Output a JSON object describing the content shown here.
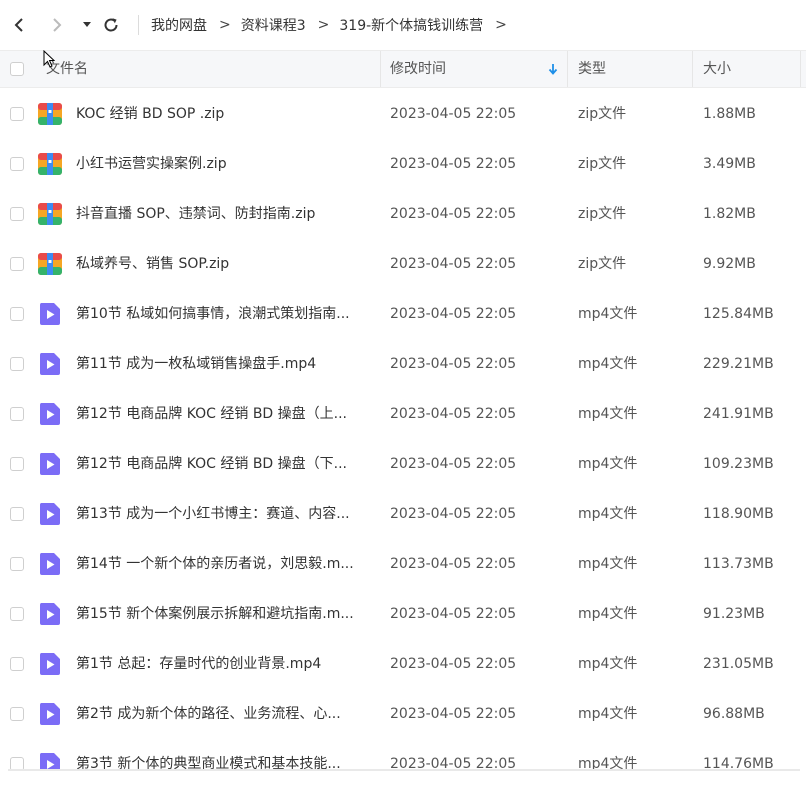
{
  "toolbar": {
    "back_icon": "chevron-left-icon",
    "forward_icon": "chevron-right-icon",
    "dropdown_icon": "caret-down-icon",
    "refresh_icon": "refresh-icon"
  },
  "breadcrumb": [
    "我的网盘",
    "资料课程3",
    "319-新个体搞钱训练营"
  ],
  "breadcrumb_separator": ">",
  "columns": {
    "name": "文件名",
    "modified": "修改时间",
    "type": "类型",
    "size": "大小"
  },
  "sort_icon": "sort-down-arrow-icon",
  "colors": {
    "accent": "#1e8fe8",
    "zip_icon": "#f5a623",
    "mp4_icon": "#7b6cf6"
  },
  "files": [
    {
      "name": "KOC 经销 BD SOP .zip",
      "modified": "2023-04-05 22:05",
      "type": "zip文件",
      "size": "1.88MB",
      "icon": "zip-file-icon"
    },
    {
      "name": "小红书运营实操案例.zip",
      "modified": "2023-04-05 22:05",
      "type": "zip文件",
      "size": "3.49MB",
      "icon": "zip-file-icon"
    },
    {
      "name": "抖音直播 SOP、违禁词、防封指南.zip",
      "modified": "2023-04-05 22:05",
      "type": "zip文件",
      "size": "1.82MB",
      "icon": "zip-file-icon"
    },
    {
      "name": "私域养号、销售 SOP.zip",
      "modified": "2023-04-05 22:05",
      "type": "zip文件",
      "size": "9.92MB",
      "icon": "zip-file-icon"
    },
    {
      "name": "第10节 私域如何搞事情，浪潮式策划指南...",
      "modified": "2023-04-05 22:05",
      "type": "mp4文件",
      "size": "125.84MB",
      "icon": "video-file-icon"
    },
    {
      "name": "第11节 成为一枚私域销售操盘手.mp4",
      "modified": "2023-04-05 22:05",
      "type": "mp4文件",
      "size": "229.21MB",
      "icon": "video-file-icon"
    },
    {
      "name": "第12节 电商品牌 KOC 经销 BD 操盘（上...",
      "modified": "2023-04-05 22:05",
      "type": "mp4文件",
      "size": "241.91MB",
      "icon": "video-file-icon"
    },
    {
      "name": "第12节 电商品牌 KOC 经销 BD 操盘（下...",
      "modified": "2023-04-05 22:05",
      "type": "mp4文件",
      "size": "109.23MB",
      "icon": "video-file-icon"
    },
    {
      "name": "第13节 成为一个小红书博主：赛道、内容...",
      "modified": "2023-04-05 22:05",
      "type": "mp4文件",
      "size": "118.90MB",
      "icon": "video-file-icon"
    },
    {
      "name": "第14节 一个新个体的亲历者说，刘思毅.m...",
      "modified": "2023-04-05 22:05",
      "type": "mp4文件",
      "size": "113.73MB",
      "icon": "video-file-icon"
    },
    {
      "name": "第15节 新个体案例展示拆解和避坑指南.m...",
      "modified": "2023-04-05 22:05",
      "type": "mp4文件",
      "size": "91.23MB",
      "icon": "video-file-icon"
    },
    {
      "name": "第1节 总起：存量时代的创业背景.mp4",
      "modified": "2023-04-05 22:05",
      "type": "mp4文件",
      "size": "231.05MB",
      "icon": "video-file-icon"
    },
    {
      "name": "第2节 成为新个体的路径、业务流程、心...",
      "modified": "2023-04-05 22:05",
      "type": "mp4文件",
      "size": "96.88MB",
      "icon": "video-file-icon"
    },
    {
      "name": "第3节 新个体的典型商业模式和基本技能...",
      "modified": "2023-04-05 22:05",
      "type": "mp4文件",
      "size": "114.76MB",
      "icon": "video-file-icon"
    }
  ]
}
